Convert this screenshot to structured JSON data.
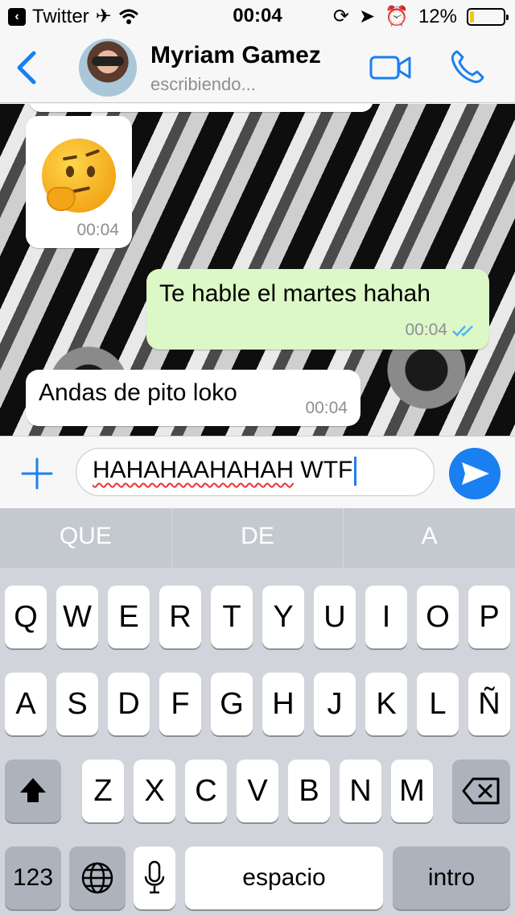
{
  "status_bar": {
    "back_app": "Twitter",
    "time": "00:04",
    "battery": "12%",
    "battery_level": 0.12
  },
  "header": {
    "contact_name": "Myriam Gamez",
    "contact_status": "escribiendo..."
  },
  "messages": [
    {
      "direction": "in",
      "type": "emoji",
      "content": "thinking-face",
      "time": "00:04"
    },
    {
      "direction": "out",
      "text": "Te hable el martes hahah",
      "time": "00:04",
      "status": "read"
    },
    {
      "direction": "in",
      "text": "Andas de pito loko",
      "time": "00:04"
    }
  ],
  "input": {
    "value_underlined": "HAHAHAAHAHAH",
    "value_rest": " WTF"
  },
  "suggestions": [
    "QUE",
    "DE",
    "A"
  ],
  "keyboard": {
    "row1": [
      "Q",
      "W",
      "E",
      "R",
      "T",
      "Y",
      "U",
      "I",
      "O",
      "P"
    ],
    "row2": [
      "A",
      "S",
      "D",
      "F",
      "G",
      "H",
      "J",
      "K",
      "L",
      "Ñ"
    ],
    "row3": [
      "Z",
      "X",
      "C",
      "V",
      "B",
      "N",
      "M"
    ],
    "numbers_key": "123",
    "space_key": "espacio",
    "return_key": "intro"
  },
  "colors": {
    "accent": "#1a7ff0",
    "outgoing_bubble": "#dcf8c6",
    "incoming_bubble": "#ffffff",
    "battery_fill": "#f5c518"
  }
}
